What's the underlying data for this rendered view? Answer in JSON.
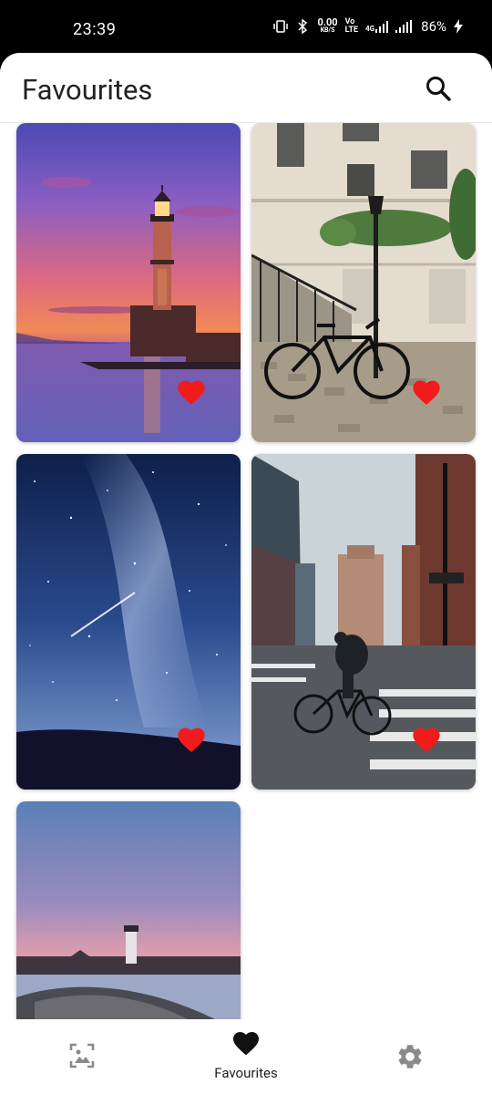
{
  "status_bar": {
    "time": "23:39",
    "speed_value": "0.00",
    "speed_unit": "KB/S",
    "volte_top": "Vo",
    "volte_bottom": "LTE",
    "network": "4G",
    "battery_percent": "86%"
  },
  "header": {
    "title": "Favourites",
    "search_icon": "search-icon"
  },
  "favourites": [
    {
      "subject": "lighthouse-sunset",
      "favourited": true
    },
    {
      "subject": "bicycle-street",
      "favourited": true
    },
    {
      "subject": "starry-sky",
      "favourited": true
    },
    {
      "subject": "city-cyclist",
      "favourited": true
    },
    {
      "subject": "lighthouse-pier",
      "favourited": false
    }
  ],
  "bottom_nav": {
    "items": [
      {
        "icon": "gallery-icon",
        "label": ""
      },
      {
        "icon": "heart-icon",
        "label": "Favourites"
      },
      {
        "icon": "gear-icon",
        "label": ""
      }
    ]
  },
  "colors": {
    "heart": "#f21b1b",
    "nav_icon_inactive": "#8a8a8a",
    "nav_icon_active": "#111111"
  }
}
